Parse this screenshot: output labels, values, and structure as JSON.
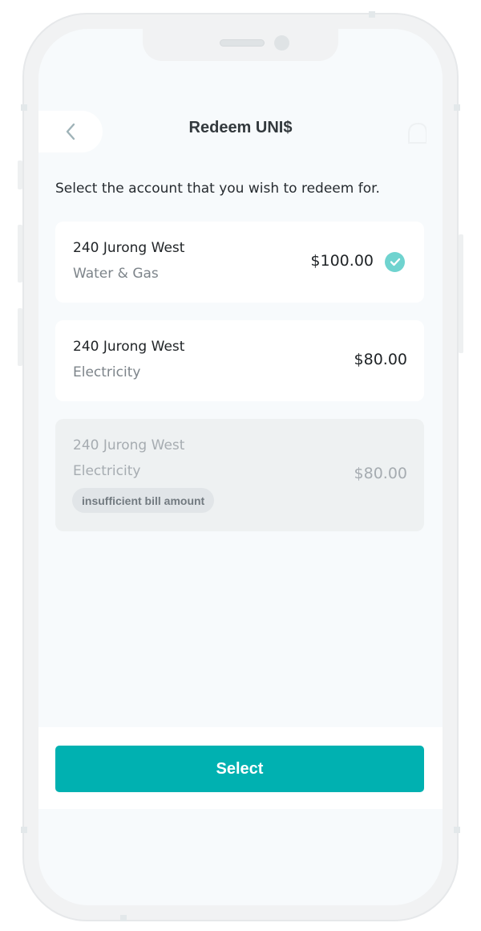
{
  "header": {
    "title": "Redeem UNI$",
    "back_icon": "chevron-left-icon",
    "notification_icon": "bell-icon"
  },
  "instruction": "Select the account that you wish to redeem for.",
  "accounts": [
    {
      "name": "240 Jurong West",
      "type": "Water & Gas",
      "amount": "$100.00",
      "selected": true,
      "disabled": false
    },
    {
      "name": "240 Jurong West",
      "type": "Electricity",
      "amount": "$80.00",
      "selected": false,
      "disabled": false
    },
    {
      "name": "240 Jurong West",
      "type": "Electricity",
      "amount": "$80.00",
      "selected": false,
      "disabled": true,
      "badge": "insufficient bill amount"
    }
  ],
  "footer": {
    "select_label": "Select"
  },
  "colors": {
    "accent": "#00b1b1",
    "check": "#6fd3cf",
    "screen_background": "#f7fafc",
    "disabled_card": "#eef1f2"
  }
}
